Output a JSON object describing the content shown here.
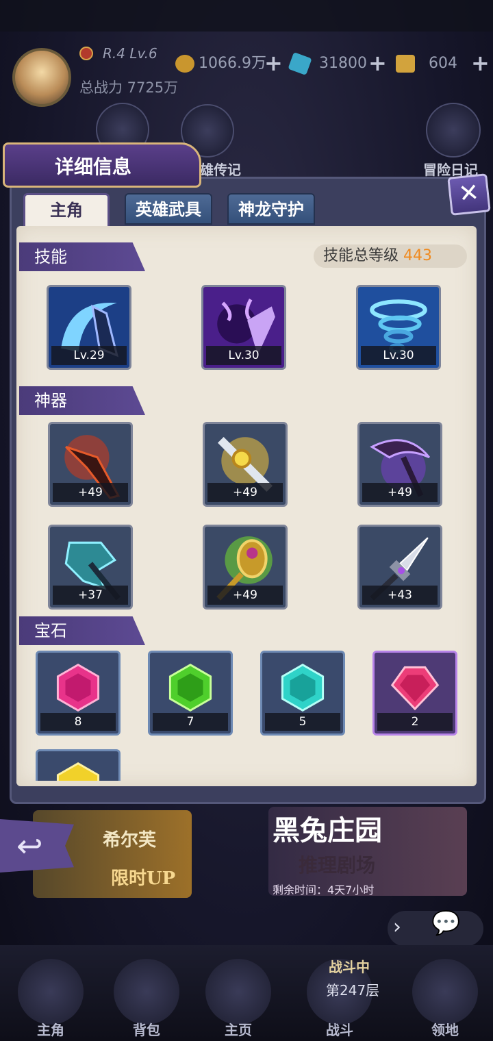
{
  "header": {
    "rank": "R.4 Lv.6",
    "power_label": "总战力 7725万",
    "gold": "1066.9万",
    "diamond": "31800",
    "ticket": "604"
  },
  "background": {
    "legend_label": "雄传记",
    "diary_label": "冒险日记",
    "banner_left_title": "希尔芙",
    "banner_left_sub": "限时UP",
    "banner_right_title": "黑兔庄园",
    "banner_right_sub": "推理剧场",
    "banner_right_time": "剩余时间：4天7小时",
    "battle_tag": "战斗中",
    "floor": "第247层",
    "nav": [
      "主角",
      "背包",
      "主页",
      "战斗",
      "领地"
    ]
  },
  "modal": {
    "title": "详细信息",
    "tabs": [
      "主角",
      "英雄武具",
      "神龙守护"
    ],
    "active_tab": 0,
    "skills": {
      "header": "技能",
      "total_label": "技能总等级",
      "total_value": "443",
      "items": [
        {
          "icon": "water-blade-icon",
          "level": "Lv.29"
        },
        {
          "icon": "shadow-slash-icon",
          "level": "Lv.30"
        },
        {
          "icon": "tornado-icon",
          "level": "Lv.30"
        }
      ]
    },
    "artifacts": {
      "header": "神器",
      "items": [
        {
          "icon": "crimson-blade-icon",
          "level": "+49"
        },
        {
          "icon": "golden-sword-icon",
          "level": "+49"
        },
        {
          "icon": "violet-scythe-icon",
          "level": "+49"
        },
        {
          "icon": "ice-axe-icon",
          "level": "+37"
        },
        {
          "icon": "jade-staff-icon",
          "level": "+49"
        },
        {
          "icon": "silver-spear-icon",
          "level": "+43"
        }
      ]
    },
    "gems": {
      "header": "宝石",
      "items": [
        {
          "icon": "pink-gem-icon",
          "count": "8",
          "color": "#e8338a"
        },
        {
          "icon": "green-gem-icon",
          "count": "7",
          "color": "#4fcf2c"
        },
        {
          "icon": "cyan-gem-icon",
          "count": "5",
          "color": "#2fd3c8"
        },
        {
          "icon": "rose-gem-icon",
          "count": "2",
          "color": "#ec3d78"
        }
      ]
    }
  }
}
